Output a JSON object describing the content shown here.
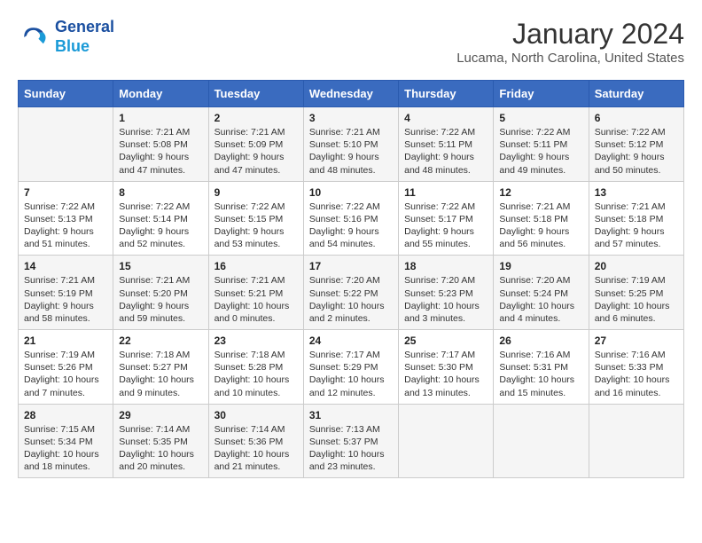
{
  "header": {
    "logo": {
      "line1": "General",
      "line2": "Blue"
    },
    "title": "January 2024",
    "location": "Lucama, North Carolina, United States"
  },
  "weekdays": [
    "Sunday",
    "Monday",
    "Tuesday",
    "Wednesday",
    "Thursday",
    "Friday",
    "Saturday"
  ],
  "weeks": [
    [
      {
        "day": null,
        "info": null
      },
      {
        "day": "1",
        "info": "Sunrise: 7:21 AM\nSunset: 5:08 PM\nDaylight: 9 hours\nand 47 minutes."
      },
      {
        "day": "2",
        "info": "Sunrise: 7:21 AM\nSunset: 5:09 PM\nDaylight: 9 hours\nand 47 minutes."
      },
      {
        "day": "3",
        "info": "Sunrise: 7:21 AM\nSunset: 5:10 PM\nDaylight: 9 hours\nand 48 minutes."
      },
      {
        "day": "4",
        "info": "Sunrise: 7:22 AM\nSunset: 5:11 PM\nDaylight: 9 hours\nand 48 minutes."
      },
      {
        "day": "5",
        "info": "Sunrise: 7:22 AM\nSunset: 5:11 PM\nDaylight: 9 hours\nand 49 minutes."
      },
      {
        "day": "6",
        "info": "Sunrise: 7:22 AM\nSunset: 5:12 PM\nDaylight: 9 hours\nand 50 minutes."
      }
    ],
    [
      {
        "day": "7",
        "info": "Sunrise: 7:22 AM\nSunset: 5:13 PM\nDaylight: 9 hours\nand 51 minutes."
      },
      {
        "day": "8",
        "info": "Sunrise: 7:22 AM\nSunset: 5:14 PM\nDaylight: 9 hours\nand 52 minutes."
      },
      {
        "day": "9",
        "info": "Sunrise: 7:22 AM\nSunset: 5:15 PM\nDaylight: 9 hours\nand 53 minutes."
      },
      {
        "day": "10",
        "info": "Sunrise: 7:22 AM\nSunset: 5:16 PM\nDaylight: 9 hours\nand 54 minutes."
      },
      {
        "day": "11",
        "info": "Sunrise: 7:22 AM\nSunset: 5:17 PM\nDaylight: 9 hours\nand 55 minutes."
      },
      {
        "day": "12",
        "info": "Sunrise: 7:21 AM\nSunset: 5:18 PM\nDaylight: 9 hours\nand 56 minutes."
      },
      {
        "day": "13",
        "info": "Sunrise: 7:21 AM\nSunset: 5:18 PM\nDaylight: 9 hours\nand 57 minutes."
      }
    ],
    [
      {
        "day": "14",
        "info": "Sunrise: 7:21 AM\nSunset: 5:19 PM\nDaylight: 9 hours\nand 58 minutes."
      },
      {
        "day": "15",
        "info": "Sunrise: 7:21 AM\nSunset: 5:20 PM\nDaylight: 9 hours\nand 59 minutes."
      },
      {
        "day": "16",
        "info": "Sunrise: 7:21 AM\nSunset: 5:21 PM\nDaylight: 10 hours\nand 0 minutes."
      },
      {
        "day": "17",
        "info": "Sunrise: 7:20 AM\nSunset: 5:22 PM\nDaylight: 10 hours\nand 2 minutes."
      },
      {
        "day": "18",
        "info": "Sunrise: 7:20 AM\nSunset: 5:23 PM\nDaylight: 10 hours\nand 3 minutes."
      },
      {
        "day": "19",
        "info": "Sunrise: 7:20 AM\nSunset: 5:24 PM\nDaylight: 10 hours\nand 4 minutes."
      },
      {
        "day": "20",
        "info": "Sunrise: 7:19 AM\nSunset: 5:25 PM\nDaylight: 10 hours\nand 6 minutes."
      }
    ],
    [
      {
        "day": "21",
        "info": "Sunrise: 7:19 AM\nSunset: 5:26 PM\nDaylight: 10 hours\nand 7 minutes."
      },
      {
        "day": "22",
        "info": "Sunrise: 7:18 AM\nSunset: 5:27 PM\nDaylight: 10 hours\nand 9 minutes."
      },
      {
        "day": "23",
        "info": "Sunrise: 7:18 AM\nSunset: 5:28 PM\nDaylight: 10 hours\nand 10 minutes."
      },
      {
        "day": "24",
        "info": "Sunrise: 7:17 AM\nSunset: 5:29 PM\nDaylight: 10 hours\nand 12 minutes."
      },
      {
        "day": "25",
        "info": "Sunrise: 7:17 AM\nSunset: 5:30 PM\nDaylight: 10 hours\nand 13 minutes."
      },
      {
        "day": "26",
        "info": "Sunrise: 7:16 AM\nSunset: 5:31 PM\nDaylight: 10 hours\nand 15 minutes."
      },
      {
        "day": "27",
        "info": "Sunrise: 7:16 AM\nSunset: 5:33 PM\nDaylight: 10 hours\nand 16 minutes."
      }
    ],
    [
      {
        "day": "28",
        "info": "Sunrise: 7:15 AM\nSunset: 5:34 PM\nDaylight: 10 hours\nand 18 minutes."
      },
      {
        "day": "29",
        "info": "Sunrise: 7:14 AM\nSunset: 5:35 PM\nDaylight: 10 hours\nand 20 minutes."
      },
      {
        "day": "30",
        "info": "Sunrise: 7:14 AM\nSunset: 5:36 PM\nDaylight: 10 hours\nand 21 minutes."
      },
      {
        "day": "31",
        "info": "Sunrise: 7:13 AM\nSunset: 5:37 PM\nDaylight: 10 hours\nand 23 minutes."
      },
      {
        "day": null,
        "info": null
      },
      {
        "day": null,
        "info": null
      },
      {
        "day": null,
        "info": null
      }
    ]
  ]
}
